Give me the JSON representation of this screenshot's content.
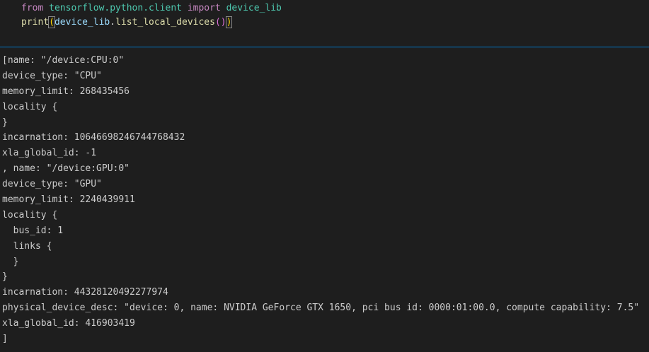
{
  "code": {
    "line1": {
      "keyword_from": "from",
      "module": "tensorflow.python.client",
      "keyword_import": "import",
      "name": "device_lib"
    },
    "line2": {
      "func": "print",
      "open_paren": "(",
      "obj": "device_lib",
      "dot": ".",
      "method": "list_local_devices",
      "inner_parens": "()",
      "close_paren": ")"
    }
  },
  "output": {
    "lines": [
      "[name: \"/device:CPU:0\"",
      "device_type: \"CPU\"",
      "memory_limit: 268435456",
      "locality {",
      "}",
      "incarnation: 10646698246744768432",
      "xla_global_id: -1",
      ", name: \"/device:GPU:0\"",
      "device_type: \"GPU\"",
      "memory_limit: 2240439911",
      "locality {",
      "  bus_id: 1",
      "  links {",
      "  }",
      "}",
      "incarnation: 4432812049227​7974",
      "physical_device_desc: \"device: 0, name: NVIDIA GeForce GTX 1650, pci bus id: 0000:01:00.0, compute capability: 7.5\"",
      "xla_global_id: 416903419",
      "]"
    ]
  },
  "colors": {
    "background": "#1e1e1e",
    "divider": "#007acc",
    "keyword": "#c586c0",
    "module": "#4ec9b0",
    "function": "#dcdcaa",
    "identifier": "#9cdcfe",
    "output_text": "#cccccc"
  }
}
